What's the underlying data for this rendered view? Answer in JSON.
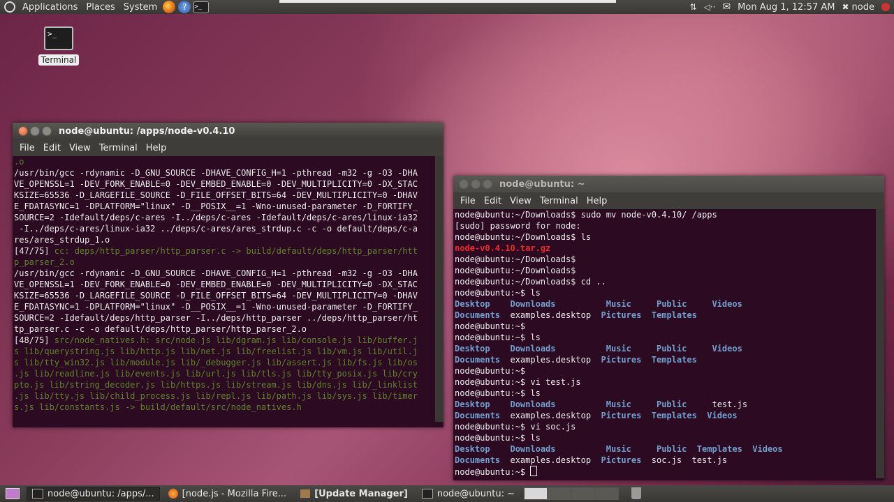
{
  "top_panel": {
    "menus": [
      "Applications",
      "Places",
      "System"
    ],
    "clock": "Mon Aug  1, 12:57 AM",
    "user": "node"
  },
  "desktop": {
    "terminal_label": "Terminal"
  },
  "window_left": {
    "title": "node@ubuntu: /apps/node-v0.4.10",
    "menu": [
      "File",
      "Edit",
      "View",
      "Terminal",
      "Help"
    ],
    "lines": [
      {
        "t": ".o",
        "c": "green"
      },
      {
        "t": "/usr/bin/gcc -rdynamic -D_GNU_SOURCE -DHAVE_CONFIG_H=1 -pthread -m32 -g -O3 -DHA",
        "c": ""
      },
      {
        "t": "VE_OPENSSL=1 -DEV_FORK_ENABLE=0 -DEV_EMBED_ENABLE=0 -DEV_MULTIPLICITY=0 -DX_STAC",
        "c": ""
      },
      {
        "t": "KSIZE=65536 -D_LARGEFILE_SOURCE -D_FILE_OFFSET_BITS=64 -DEV_MULTIPLICITY=0 -DHAV",
        "c": ""
      },
      {
        "t": "E_FDATASYNC=1 -DPLATFORM=\"linux\" -D__POSIX__=1 -Wno-unused-parameter -D_FORTIFY_",
        "c": ""
      },
      {
        "t": "SOURCE=2 -Idefault/deps/c-ares -I../deps/c-ares -Idefault/deps/c-ares/linux-ia32",
        "c": ""
      },
      {
        "t": " -I../deps/c-ares/linux-ia32 ../deps/c-ares/ares_strdup.c -c -o default/deps/c-a",
        "c": ""
      },
      {
        "t": "res/ares_strdup_1.o",
        "c": ""
      },
      {
        "t": "[47/75] cc: deps/http_parser/http_parser.c -> build/default/deps/http_parser/htt",
        "c": "mix47"
      },
      {
        "t": "p_parser_2.o",
        "c": "green"
      },
      {
        "t": "/usr/bin/gcc -rdynamic -D_GNU_SOURCE -DHAVE_CONFIG_H=1 -pthread -m32 -g -O3 -DHA",
        "c": ""
      },
      {
        "t": "VE_OPENSSL=1 -DEV_FORK_ENABLE=0 -DEV_EMBED_ENABLE=0 -DEV_MULTIPLICITY=0 -DX_STAC",
        "c": ""
      },
      {
        "t": "KSIZE=65536 -D_LARGEFILE_SOURCE -D_FILE_OFFSET_BITS=64 -DEV_MULTIPLICITY=0 -DHAV",
        "c": ""
      },
      {
        "t": "E_FDATASYNC=1 -DPLATFORM=\"linux\" -D__POSIX__=1 -Wno-unused-parameter -D_FORTIFY_",
        "c": ""
      },
      {
        "t": "SOURCE=2 -Idefault/deps/http_parser -I../deps/http_parser ../deps/http_parser/ht",
        "c": ""
      },
      {
        "t": "tp_parser.c -c -o default/deps/http_parser/http_parser_2.o",
        "c": ""
      },
      {
        "t": "[48/75] src/node_natives.h: src/node.js lib/dgram.js lib/console.js lib/buffer.j",
        "c": "mix48"
      },
      {
        "t": "s lib/querystring.js lib/http.js lib/net.js lib/freelist.js lib/vm.js lib/util.j",
        "c": "green"
      },
      {
        "t": "s lib/tty_win32.js lib/module.js lib/_debugger.js lib/assert.js lib/fs.js lib/os",
        "c": "green"
      },
      {
        "t": ".js lib/readline.js lib/events.js lib/url.js lib/tls.js lib/tty_posix.js lib/cry",
        "c": "green"
      },
      {
        "t": "pto.js lib/string_decoder.js lib/https.js lib/stream.js lib/dns.js lib/_linklist",
        "c": "green"
      },
      {
        "t": ".js lib/tty.js lib/child_process.js lib/repl.js lib/path.js lib/sys.js lib/timer",
        "c": "green"
      },
      {
        "t": "s.js lib/constants.js -> build/default/src/node_natives.h",
        "c": "green"
      }
    ]
  },
  "window_right": {
    "title": "node@ubuntu: ~",
    "menu": [
      "File",
      "Edit",
      "View",
      "Terminal",
      "Help"
    ],
    "lines": [
      [
        {
          "t": "node@ubuntu:~/Downloads$ sudo mv node-v0.4.10/ /apps",
          "c": ""
        }
      ],
      [
        {
          "t": "[sudo] password for node:",
          "c": ""
        }
      ],
      [
        {
          "t": "node@ubuntu:~/Downloads$ ls",
          "c": ""
        }
      ],
      [
        {
          "t": "node-v0.4.10.tar.gz",
          "c": "red"
        }
      ],
      [
        {
          "t": "node@ubuntu:~/Downloads$",
          "c": ""
        }
      ],
      [
        {
          "t": "node@ubuntu:~/Downloads$",
          "c": ""
        }
      ],
      [
        {
          "t": "node@ubuntu:~/Downloads$ cd ..",
          "c": ""
        }
      ],
      [
        {
          "t": "node@ubuntu:~$ ls",
          "c": ""
        }
      ],
      [
        {
          "t": "Desktop    Downloads          Music     Public     Videos",
          "c": "blue"
        }
      ],
      [
        {
          "t": "Documents",
          "c": "blue"
        },
        {
          "t": "  examples.desktop  ",
          "c": ""
        },
        {
          "t": "Pictures  Templates",
          "c": "blue"
        }
      ],
      [
        {
          "t": "node@ubuntu:~$",
          "c": ""
        }
      ],
      [
        {
          "t": "node@ubuntu:~$ ls",
          "c": ""
        }
      ],
      [
        {
          "t": "Desktop    Downloads          Music     Public     Videos",
          "c": "blue"
        }
      ],
      [
        {
          "t": "Documents",
          "c": "blue"
        },
        {
          "t": "  examples.desktop  ",
          "c": ""
        },
        {
          "t": "Pictures  Templates",
          "c": "blue"
        }
      ],
      [
        {
          "t": "node@ubuntu:~$",
          "c": ""
        }
      ],
      [
        {
          "t": "node@ubuntu:~$ vi test.js",
          "c": ""
        }
      ],
      [
        {
          "t": "node@ubuntu:~$ ls",
          "c": ""
        }
      ],
      [
        {
          "t": "Desktop    Downloads          Music     Public     ",
          "c": "blue"
        },
        {
          "t": "test.js",
          "c": ""
        }
      ],
      [
        {
          "t": "Documents",
          "c": "blue"
        },
        {
          "t": "  examples.desktop  ",
          "c": ""
        },
        {
          "t": "Pictures  Templates  Videos",
          "c": "blue"
        }
      ],
      [
        {
          "t": "node@ubuntu:~$ vi soc.js",
          "c": ""
        }
      ],
      [
        {
          "t": "node@ubuntu:~$ ls",
          "c": ""
        }
      ],
      [
        {
          "t": "Desktop    Downloads          Music     Public  Templates  Videos",
          "c": "blue"
        }
      ],
      [
        {
          "t": "Documents",
          "c": "blue"
        },
        {
          "t": "  examples.desktop  ",
          "c": ""
        },
        {
          "t": "Pictures",
          "c": "blue"
        },
        {
          "t": "  soc.js  test.js",
          "c": ""
        }
      ],
      [
        {
          "t": "node@ubuntu:~$ ",
          "c": ""
        }
      ]
    ]
  },
  "taskbar": {
    "tasks": [
      "node@ubuntu: /apps/...",
      "[node.js - Mozilla Fire...",
      "[Update Manager]",
      "node@ubuntu: ~"
    ]
  }
}
